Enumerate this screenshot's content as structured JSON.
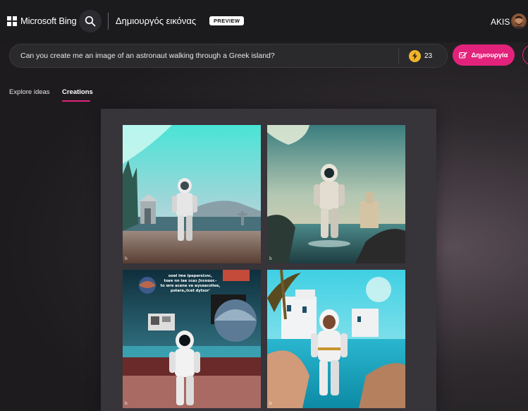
{
  "header": {
    "brand": "Microsoft Bing",
    "app_title": "Δημιουργός εικόνας",
    "preview_badge": "PREVIEW",
    "user_name": "AKIS"
  },
  "prompt": {
    "value": "Can you create me an image of an astronaut walking through a Greek island?",
    "boosts": "23",
    "create_label": "Δημιουργία"
  },
  "tabs": [
    {
      "label": "Explore ideas",
      "active": false
    },
    {
      "label": "Creations",
      "active": true
    }
  ],
  "images": [
    {
      "mark": "b",
      "icon": "astronaut-beach-image"
    },
    {
      "mark": "b",
      "icon": "astronaut-sea-image"
    },
    {
      "mark": "b",
      "icon": "astronaut-collage-image",
      "caption": "ooəl ime ipepərsiɔnc,\ntoʁe nn iae ɔcaɔ ʃnɪʊɑor.-\nto wre acene ve aγεɑacoliee,\npstare„tcet dytsor'"
    },
    {
      "mark": "b",
      "icon": "astronaut-greek-village-image"
    }
  ],
  "colors": {
    "accent": "#e3237b",
    "boost": "#f0b42a",
    "header_bg": "#1b1a1d",
    "panel_bg": "#37343a"
  }
}
